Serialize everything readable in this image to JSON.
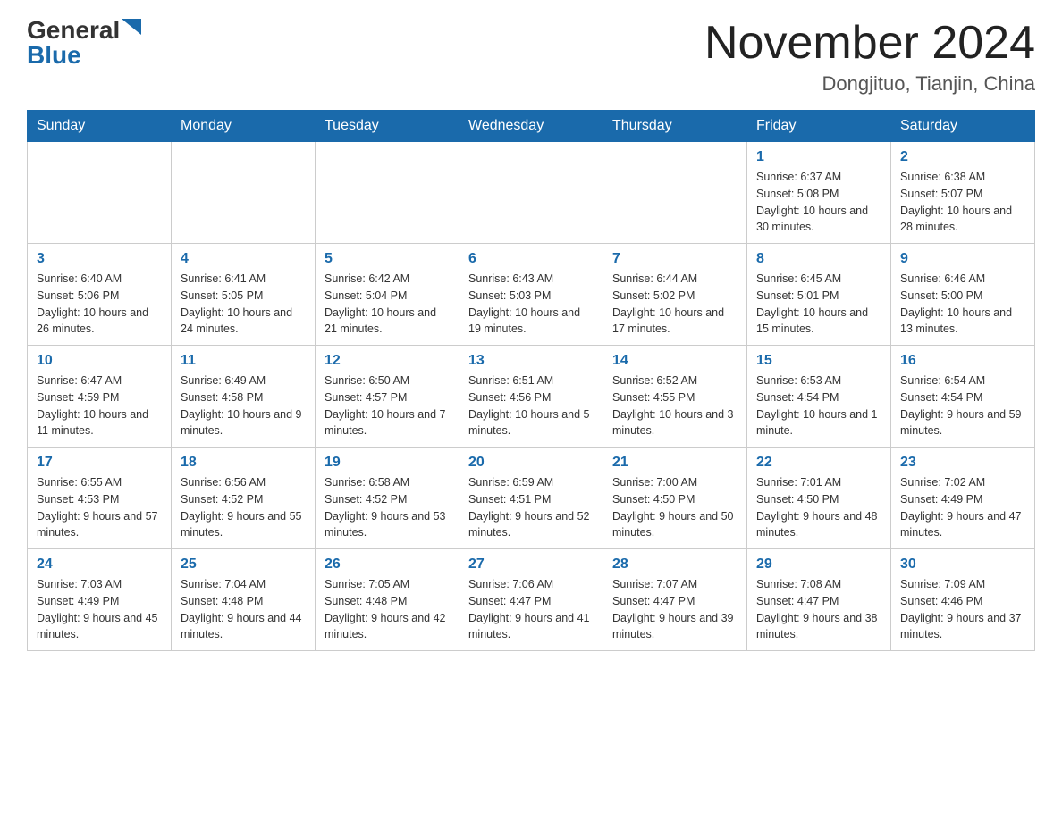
{
  "logo": {
    "general": "General",
    "blue": "Blue"
  },
  "header": {
    "month": "November 2024",
    "location": "Dongjituo, Tianjin, China"
  },
  "days_of_week": [
    "Sunday",
    "Monday",
    "Tuesday",
    "Wednesday",
    "Thursday",
    "Friday",
    "Saturday"
  ],
  "weeks": [
    [
      {
        "day": "",
        "info": ""
      },
      {
        "day": "",
        "info": ""
      },
      {
        "day": "",
        "info": ""
      },
      {
        "day": "",
        "info": ""
      },
      {
        "day": "",
        "info": ""
      },
      {
        "day": "1",
        "info": "Sunrise: 6:37 AM\nSunset: 5:08 PM\nDaylight: 10 hours and 30 minutes."
      },
      {
        "day": "2",
        "info": "Sunrise: 6:38 AM\nSunset: 5:07 PM\nDaylight: 10 hours and 28 minutes."
      }
    ],
    [
      {
        "day": "3",
        "info": "Sunrise: 6:40 AM\nSunset: 5:06 PM\nDaylight: 10 hours and 26 minutes."
      },
      {
        "day": "4",
        "info": "Sunrise: 6:41 AM\nSunset: 5:05 PM\nDaylight: 10 hours and 24 minutes."
      },
      {
        "day": "5",
        "info": "Sunrise: 6:42 AM\nSunset: 5:04 PM\nDaylight: 10 hours and 21 minutes."
      },
      {
        "day": "6",
        "info": "Sunrise: 6:43 AM\nSunset: 5:03 PM\nDaylight: 10 hours and 19 minutes."
      },
      {
        "day": "7",
        "info": "Sunrise: 6:44 AM\nSunset: 5:02 PM\nDaylight: 10 hours and 17 minutes."
      },
      {
        "day": "8",
        "info": "Sunrise: 6:45 AM\nSunset: 5:01 PM\nDaylight: 10 hours and 15 minutes."
      },
      {
        "day": "9",
        "info": "Sunrise: 6:46 AM\nSunset: 5:00 PM\nDaylight: 10 hours and 13 minutes."
      }
    ],
    [
      {
        "day": "10",
        "info": "Sunrise: 6:47 AM\nSunset: 4:59 PM\nDaylight: 10 hours and 11 minutes."
      },
      {
        "day": "11",
        "info": "Sunrise: 6:49 AM\nSunset: 4:58 PM\nDaylight: 10 hours and 9 minutes."
      },
      {
        "day": "12",
        "info": "Sunrise: 6:50 AM\nSunset: 4:57 PM\nDaylight: 10 hours and 7 minutes."
      },
      {
        "day": "13",
        "info": "Sunrise: 6:51 AM\nSunset: 4:56 PM\nDaylight: 10 hours and 5 minutes."
      },
      {
        "day": "14",
        "info": "Sunrise: 6:52 AM\nSunset: 4:55 PM\nDaylight: 10 hours and 3 minutes."
      },
      {
        "day": "15",
        "info": "Sunrise: 6:53 AM\nSunset: 4:54 PM\nDaylight: 10 hours and 1 minute."
      },
      {
        "day": "16",
        "info": "Sunrise: 6:54 AM\nSunset: 4:54 PM\nDaylight: 9 hours and 59 minutes."
      }
    ],
    [
      {
        "day": "17",
        "info": "Sunrise: 6:55 AM\nSunset: 4:53 PM\nDaylight: 9 hours and 57 minutes."
      },
      {
        "day": "18",
        "info": "Sunrise: 6:56 AM\nSunset: 4:52 PM\nDaylight: 9 hours and 55 minutes."
      },
      {
        "day": "19",
        "info": "Sunrise: 6:58 AM\nSunset: 4:52 PM\nDaylight: 9 hours and 53 minutes."
      },
      {
        "day": "20",
        "info": "Sunrise: 6:59 AM\nSunset: 4:51 PM\nDaylight: 9 hours and 52 minutes."
      },
      {
        "day": "21",
        "info": "Sunrise: 7:00 AM\nSunset: 4:50 PM\nDaylight: 9 hours and 50 minutes."
      },
      {
        "day": "22",
        "info": "Sunrise: 7:01 AM\nSunset: 4:50 PM\nDaylight: 9 hours and 48 minutes."
      },
      {
        "day": "23",
        "info": "Sunrise: 7:02 AM\nSunset: 4:49 PM\nDaylight: 9 hours and 47 minutes."
      }
    ],
    [
      {
        "day": "24",
        "info": "Sunrise: 7:03 AM\nSunset: 4:49 PM\nDaylight: 9 hours and 45 minutes."
      },
      {
        "day": "25",
        "info": "Sunrise: 7:04 AM\nSunset: 4:48 PM\nDaylight: 9 hours and 44 minutes."
      },
      {
        "day": "26",
        "info": "Sunrise: 7:05 AM\nSunset: 4:48 PM\nDaylight: 9 hours and 42 minutes."
      },
      {
        "day": "27",
        "info": "Sunrise: 7:06 AM\nSunset: 4:47 PM\nDaylight: 9 hours and 41 minutes."
      },
      {
        "day": "28",
        "info": "Sunrise: 7:07 AM\nSunset: 4:47 PM\nDaylight: 9 hours and 39 minutes."
      },
      {
        "day": "29",
        "info": "Sunrise: 7:08 AM\nSunset: 4:47 PM\nDaylight: 9 hours and 38 minutes."
      },
      {
        "day": "30",
        "info": "Sunrise: 7:09 AM\nSunset: 4:46 PM\nDaylight: 9 hours and 37 minutes."
      }
    ]
  ]
}
